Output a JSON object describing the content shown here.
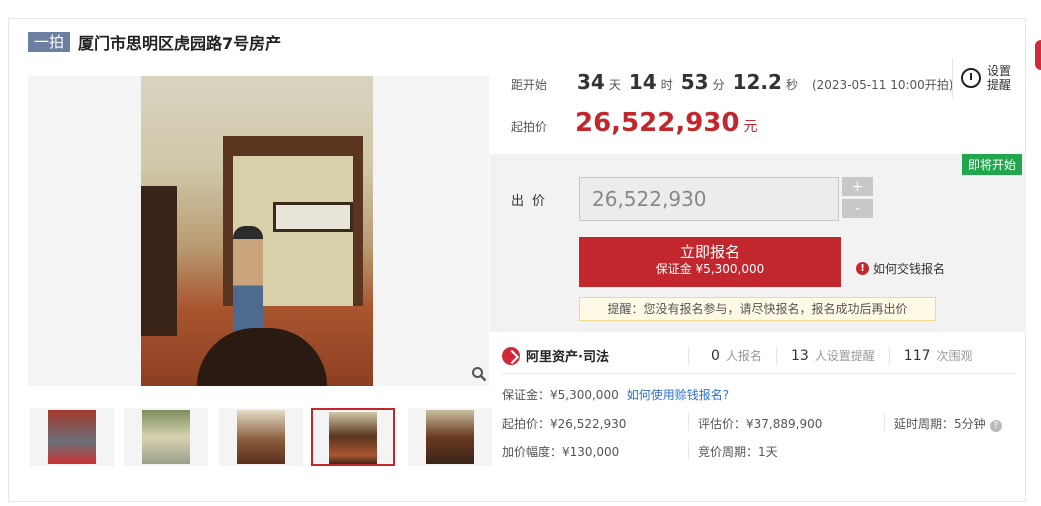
{
  "header": {
    "badge": "一拍",
    "title": "厦门市思明区虎园路7号房产"
  },
  "countdown": {
    "label": "距开始",
    "days": "34",
    "days_unit": "天",
    "hours": "14",
    "hours_unit": "时",
    "minutes": "53",
    "minutes_unit": "分",
    "seconds": "12.2",
    "seconds_unit": "秒",
    "start_time": "(2023-05-11 10:00开拍)"
  },
  "reminder": {
    "label": "设置提醒",
    "icon": "alarm-clock-icon"
  },
  "start_price": {
    "label": "起拍价",
    "value": "26,522,930",
    "currency": "元"
  },
  "bid": {
    "status": "即将开始",
    "label": "出价",
    "input_value": "26,522,930",
    "plus": "+",
    "minus": "-",
    "register_button": "立即报名",
    "register_deposit": "保证金 ¥5,300,000",
    "howto": "如何交钱报名",
    "notice": "提醒：您没有报名参与，请尽快报名，报名成功后再出价"
  },
  "stats": {
    "brand": "阿里资产·司法",
    "signups": "0",
    "signups_label": "人报名",
    "reminders": "13",
    "reminders_label": "人设置提醒",
    "views": "117",
    "views_label": "次围观"
  },
  "details": {
    "deposit": "保证金：¥5,300,000",
    "deposit_link": "如何使用赊钱报名?",
    "start_price": "起拍价：¥26,522,930",
    "increment": "加价幅度：¥130,000",
    "appraisal": "评估价：¥37,889,900",
    "cycle": "竞价周期：1天",
    "delay": "延时周期：5分钟"
  },
  "colors": {
    "accent": "#c1272d",
    "badge": "#6b7fa3",
    "status_green": "#21a64b",
    "link": "#2d6fd6"
  }
}
